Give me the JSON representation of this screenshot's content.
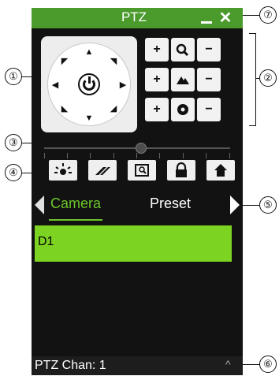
{
  "window": {
    "title": "PTZ"
  },
  "title_buttons": {
    "minimize_icon": "minimize-icon",
    "close_icon": "close-icon",
    "close_glyph": "✕"
  },
  "dpad": {
    "arrows": [
      "▲",
      "◥",
      "▶",
      "◢",
      "▼",
      "◣",
      "◀",
      "◤"
    ],
    "center_icon": "power-icon"
  },
  "controls": {
    "rows": [
      {
        "name": "zoom",
        "plus": "+",
        "minus": "−",
        "icon": "magnifier-icon"
      },
      {
        "name": "focus",
        "plus": "+",
        "minus": "−",
        "icon": "mountain-icon"
      },
      {
        "name": "iris",
        "plus": "+",
        "minus": "−",
        "icon": "aperture-icon"
      }
    ]
  },
  "speed_slider": {
    "value_fraction": 0.5,
    "ticks": 9
  },
  "toolbar": {
    "buttons": [
      {
        "icon": "light-icon"
      },
      {
        "icon": "wiper-icon"
      },
      {
        "icon": "screen-icon"
      },
      {
        "icon": "lock-icon"
      },
      {
        "icon": "home-icon"
      }
    ]
  },
  "tabs": {
    "camera": "Camera",
    "preset": "Preset",
    "active": "Camera"
  },
  "list": {
    "items": [
      "D1"
    ],
    "selected": "D1"
  },
  "status": {
    "chan_label": "PTZ Chan: 1",
    "caret": "^"
  },
  "callouts": [
    "①",
    "②",
    "③",
    "④",
    "⑤",
    "⑥",
    "⑦"
  ],
  "colors": {
    "accent": "#6cc52a",
    "title_bar": "#4a9a2c",
    "selection": "#7dd321",
    "panel": "#121212"
  }
}
